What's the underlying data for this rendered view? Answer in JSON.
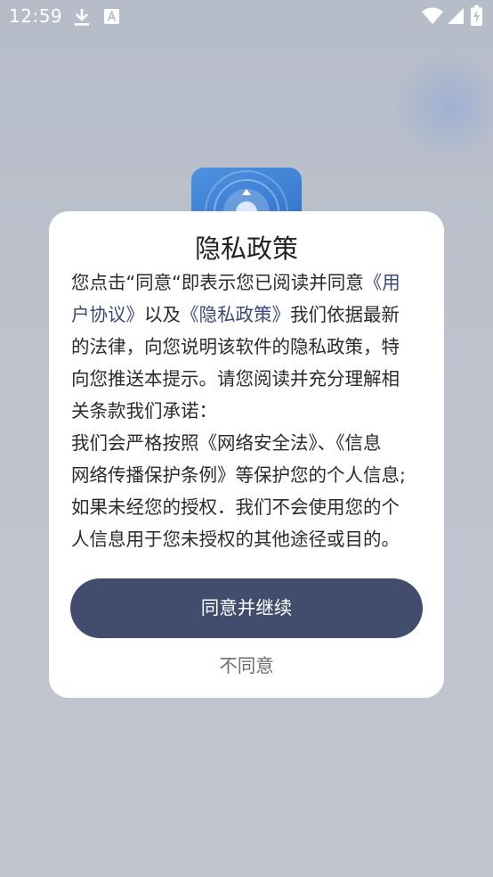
{
  "status_bar": {
    "time": "12:59",
    "icons": [
      "download-icon",
      "a-notification-icon",
      "wifi-icon",
      "signal-icon",
      "battery-charging-icon"
    ]
  },
  "app": {
    "icon": "app-logo-icon"
  },
  "dialog": {
    "title": "隐私政策",
    "body_lines": [
      [
        {
          "text": "您点击“同意“即表示您已阅读并同意",
          "link": false
        },
        {
          "text": "《用",
          "link": true
        }
      ],
      [
        {
          "text": "户协议》",
          "link": true
        },
        {
          "text": "以及",
          "link": false
        },
        {
          "text": "《隐私政策》",
          "link": true
        },
        {
          "text": "我们依据最新",
          "link": false
        }
      ],
      [
        {
          "text": "的法律，向您说明该软件的隐私政策，特",
          "link": false
        }
      ],
      [
        {
          "text": "向您推送本提示。请您阅读并充分理解相",
          "link": false
        }
      ],
      [
        {
          "text": "关条款我们承诺：",
          "link": false
        }
      ],
      [
        {
          "text": "我们会严格按照《网络安全法》、《信息",
          "link": false
        }
      ],
      [
        {
          "text": "网络传播保护条例》等保护您的个人信息;",
          "link": false
        }
      ],
      [
        {
          "text": "如果未经您的授权．我们不会使用您的个",
          "link": false
        }
      ],
      [
        {
          "text": "人信息用于您未授权的其他途径或目的。",
          "link": false
        }
      ]
    ],
    "agree_label": "同意并继续",
    "disagree_label": "不同意"
  },
  "colors": {
    "link": "#3c4a78",
    "primary_button": "#424d6e",
    "dialog_bg": "#ffffff",
    "backdrop": "#bec3cd"
  }
}
